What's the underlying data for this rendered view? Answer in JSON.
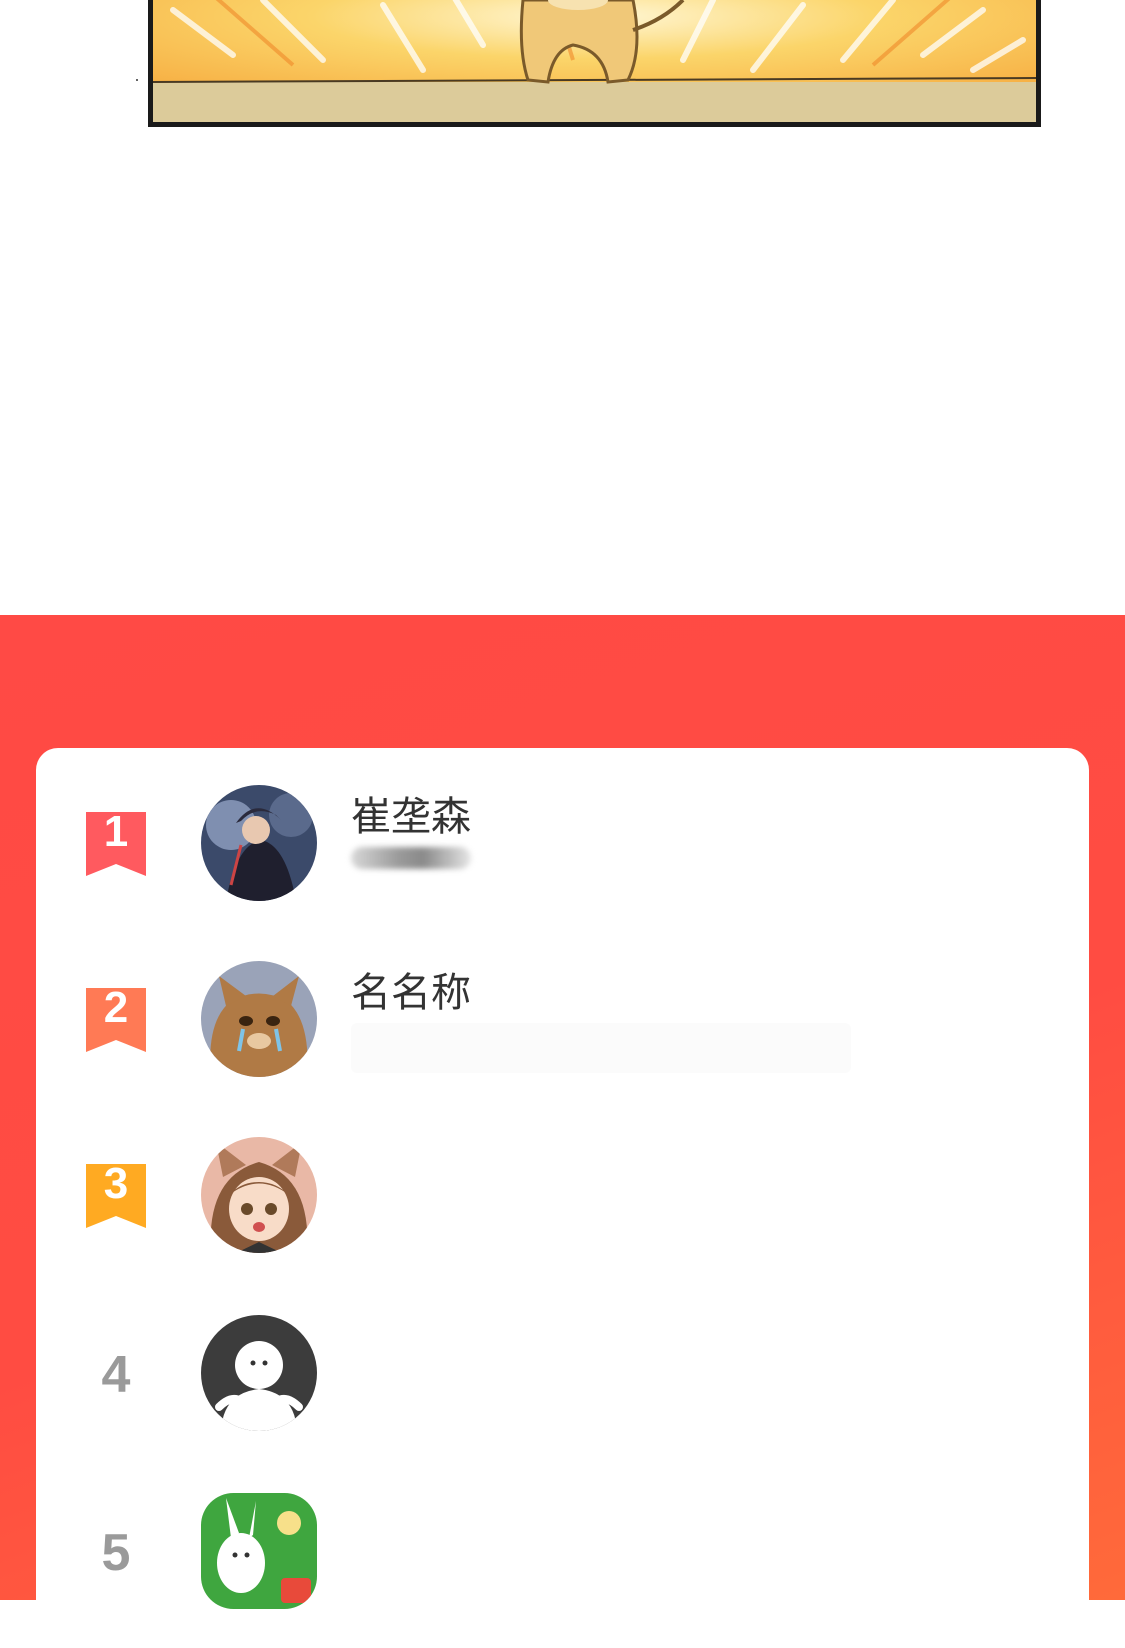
{
  "comic": {
    "alt": ""
  },
  "ranking": {
    "rows": [
      {
        "rank": "1",
        "name": "崔垄森",
        "badge_color": "#ff5a5f",
        "avatar": "dark-character-avatar"
      },
      {
        "rank": "2",
        "name": "名名称",
        "badge_color": "#ff7a55",
        "avatar": "crying-cat-avatar"
      },
      {
        "rank": "3",
        "name": "",
        "badge_color": "#ffaa22",
        "avatar": "cat-ear-girl-avatar"
      },
      {
        "rank": "4",
        "name": "",
        "avatar": "default-user-avatar"
      },
      {
        "rank": "5",
        "name": "",
        "avatar": "green-rabbit-avatar"
      }
    ]
  },
  "colors": {
    "section_bg": "#ff4a45",
    "card_bg": "#ffffff",
    "rank_plain": "#9a9a9a"
  }
}
